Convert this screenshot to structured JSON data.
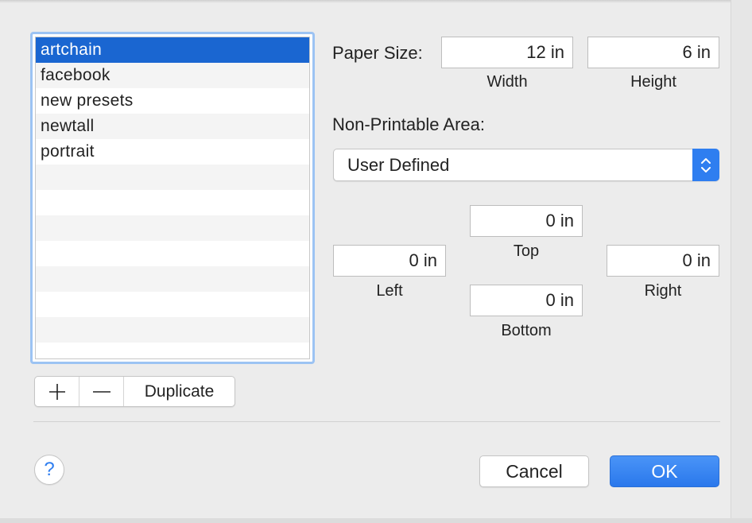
{
  "presets": {
    "items": [
      "artchain",
      "facebook",
      "new presets",
      "newtall",
      "portrait",
      "",
      "",
      "",
      "",
      "",
      "",
      "",
      ""
    ],
    "selected_index": 0
  },
  "list_buttons": {
    "add_label": "+",
    "remove_label": "—",
    "duplicate_label": "Duplicate"
  },
  "paper_size": {
    "label": "Paper Size:",
    "width_value": "12 in",
    "width_label": "Width",
    "height_value": "6 in",
    "height_label": "Height"
  },
  "non_printable": {
    "label": "Non-Printable Area:",
    "selected": "User Defined",
    "top_value": "0 in",
    "top_label": "Top",
    "left_value": "0 in",
    "left_label": "Left",
    "right_value": "0 in",
    "right_label": "Right",
    "bottom_value": "0 in",
    "bottom_label": "Bottom"
  },
  "footer": {
    "help_label": "?",
    "cancel_label": "Cancel",
    "ok_label": "OK"
  },
  "colors": {
    "accent": "#2f7ef0",
    "selection": "#1a66d1",
    "focus_ring": "#9cc3f3"
  },
  "icons": {
    "help": "question-mark-icon",
    "select": "up-down-chevron-icon"
  }
}
